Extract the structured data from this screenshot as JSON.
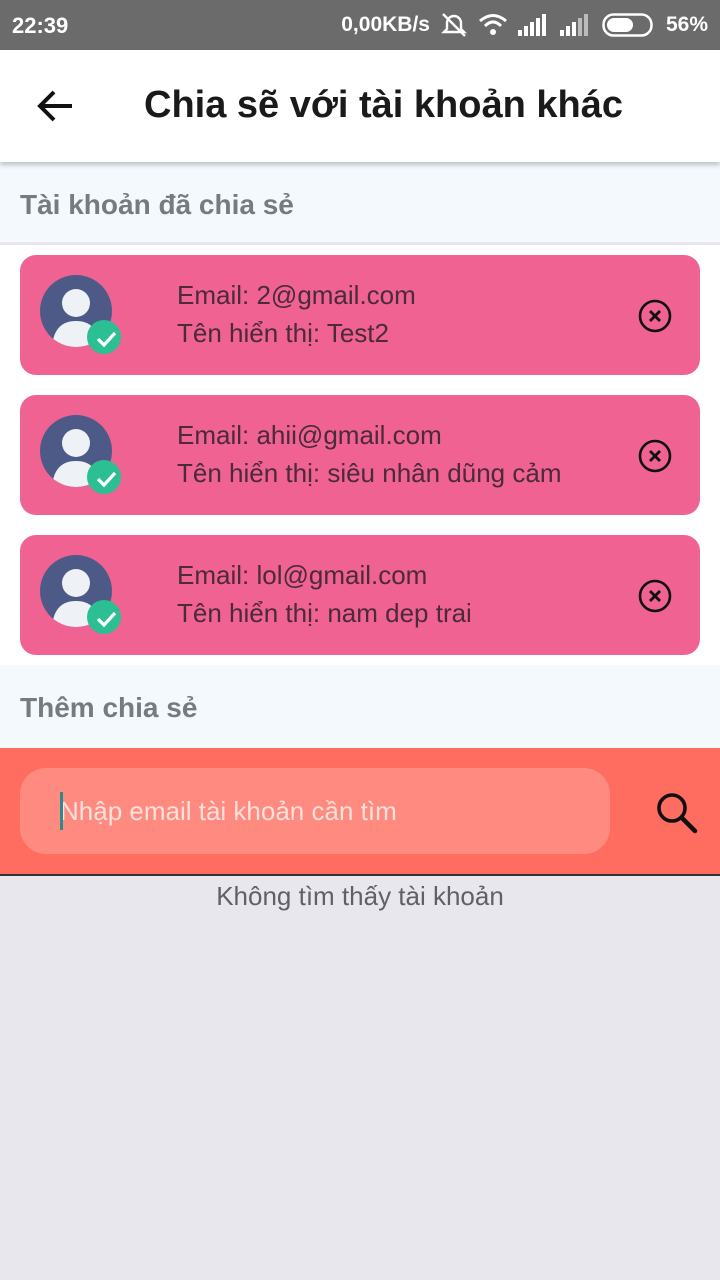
{
  "status_bar": {
    "time": "22:39",
    "network_speed": "0,00KB/s",
    "battery_percent": "56%",
    "icons": [
      "alarm-off-icon",
      "wifi-icon",
      "signal-icon",
      "signal-icon",
      "battery-icon"
    ]
  },
  "app_bar": {
    "back_icon": "arrow-left-icon",
    "title": "Chia sẽ với tài khoản khác"
  },
  "shared_section": {
    "title": "Tài khoản đã chia sẻ",
    "accounts": [
      {
        "email": "Email: 2@gmail.com",
        "display_name": "Tên hiển thị: Test2"
      },
      {
        "email": "Email: ahii@gmail.com",
        "display_name": "Tên hiển thị: siêu nhân dũng cảm"
      },
      {
        "email": "Email: lol@gmail.com",
        "display_name": "Tên hiển thị: nam dep trai"
      }
    ]
  },
  "add_section": {
    "title": "Thêm chia sẻ",
    "search_value": "",
    "search_placeholder": "Nhập email tài khoản cần tìm",
    "search_icon": "search-icon"
  },
  "result": {
    "empty_message": "Không tìm thấy tài khoản"
  },
  "colors": {
    "card": "#f06292",
    "search_bar": "#ff6d60",
    "verified_badge": "#2cbf93",
    "avatar": "#4d5a87"
  }
}
